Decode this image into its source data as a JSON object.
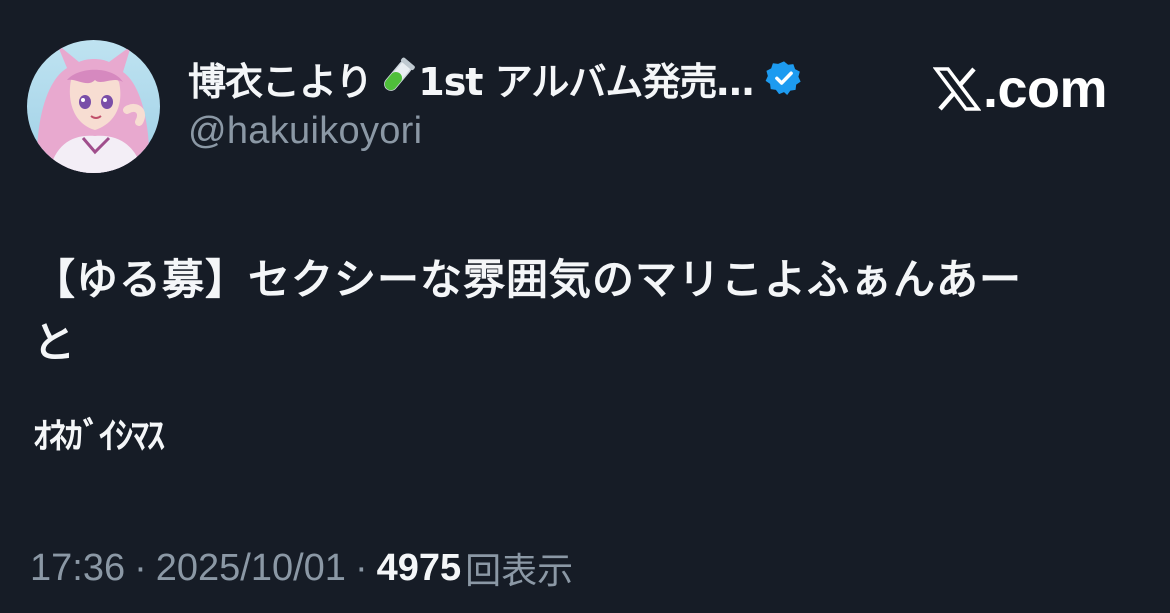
{
  "author": {
    "display_name": "博衣こより",
    "name_suffix": "1st アルバム発売…",
    "handle": "@hakuikoyori",
    "tube_icon": "test-tube-icon",
    "verified_icon": "verified-badge-icon",
    "verified_color": "#1d9bf0"
  },
  "brand": {
    "logo": "x-logo-icon",
    "domain": ".com"
  },
  "post": {
    "line1": "【ゆる募】セクシーな雰囲気のマリこよふぁんあー",
    "line2": "と",
    "line3": "ｵﾈｶﾞｲｼﾏｽ"
  },
  "meta": {
    "time": "17:36",
    "separator": "·",
    "date": "2025/10/01",
    "views_count": "4975",
    "views_label": "回表示"
  },
  "colors": {
    "background": "#161c26",
    "text": "#f4f6f8",
    "muted": "#8b98a5"
  }
}
